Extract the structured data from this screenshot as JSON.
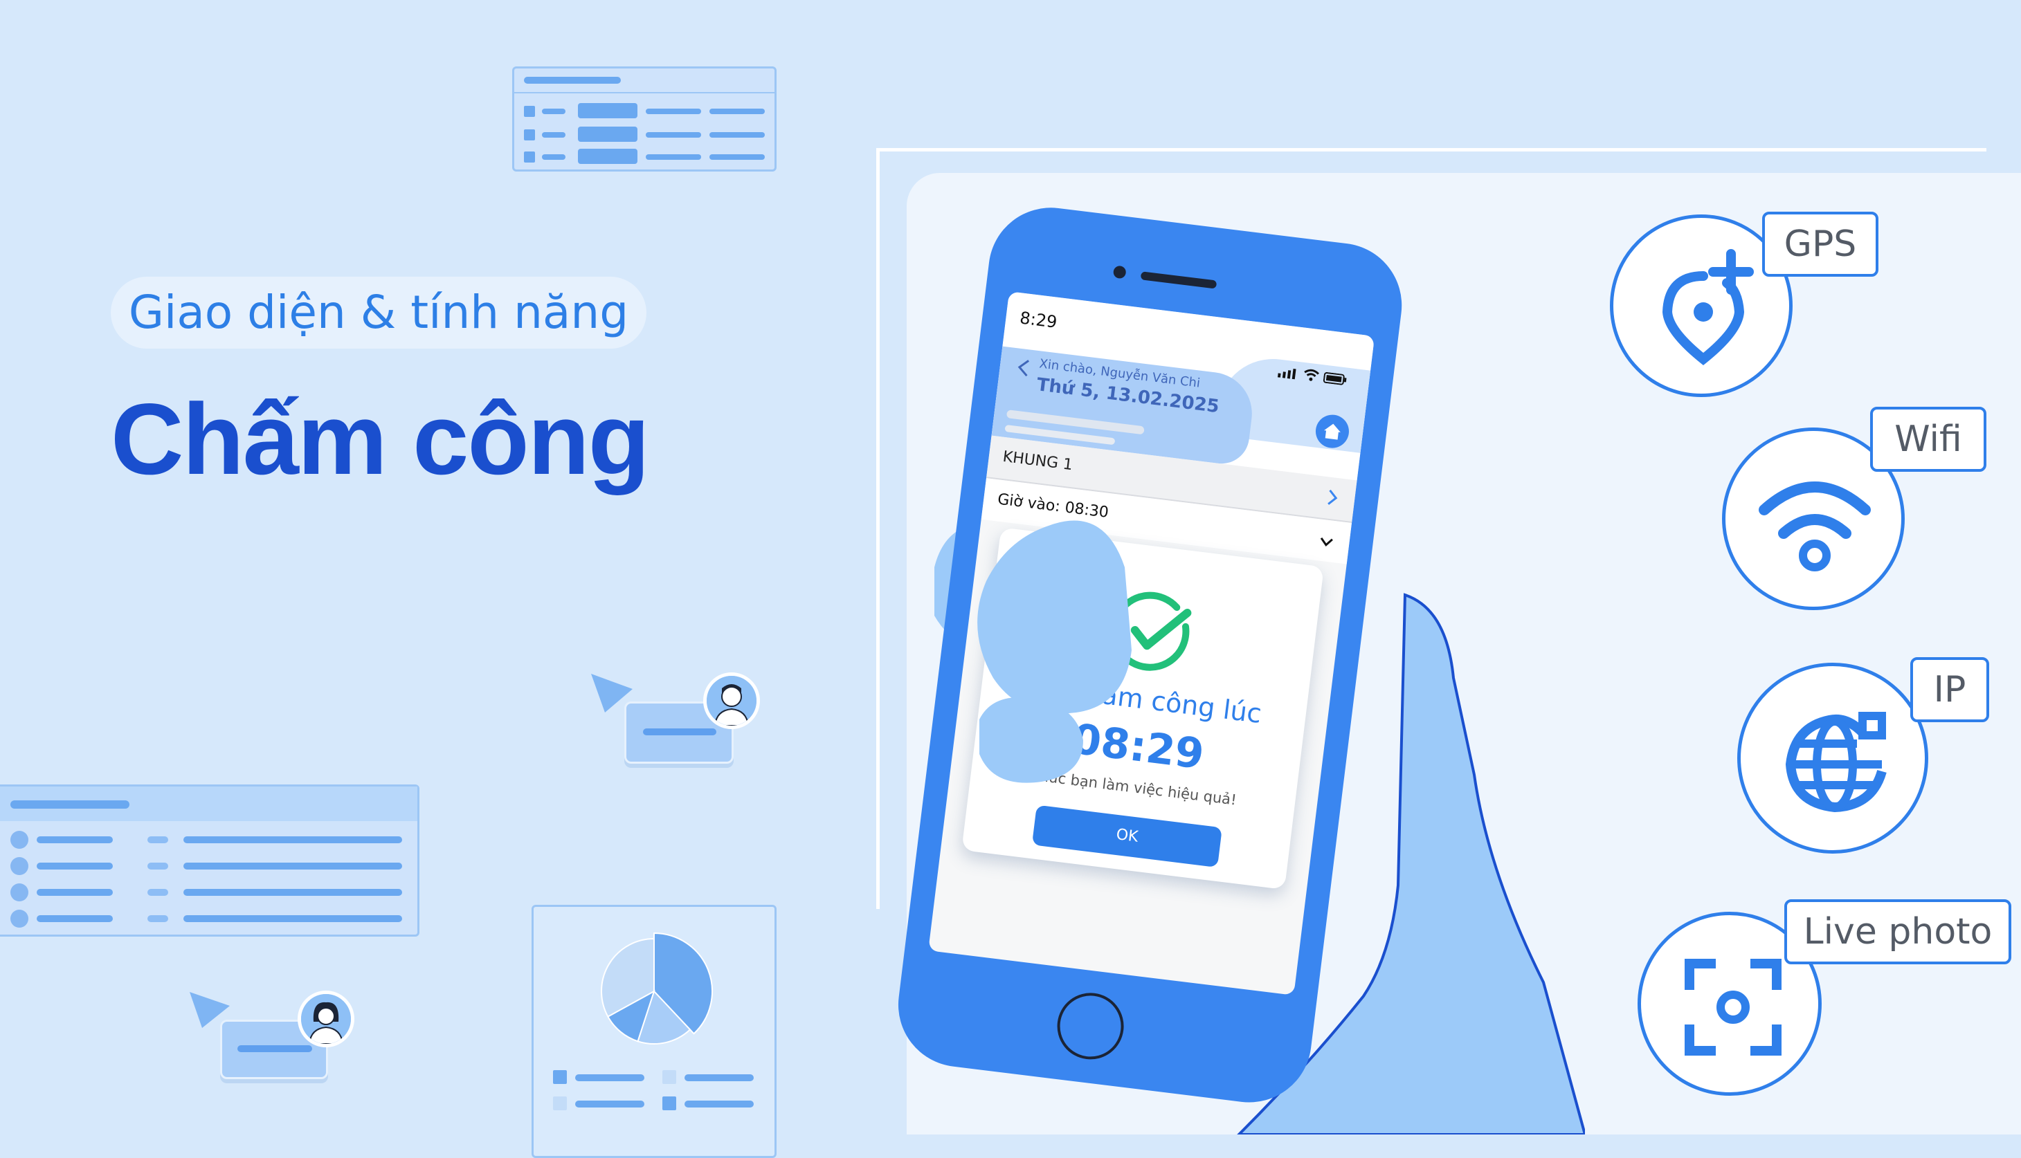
{
  "headline": {
    "subtitle": "Giao diện & tính năng",
    "title": "Chấm công"
  },
  "features": [
    {
      "label": "GPS",
      "icon": "location-add-icon"
    },
    {
      "label": "Wifi",
      "icon": "wifi-icon"
    },
    {
      "label": "IP",
      "icon": "globe-icon"
    },
    {
      "label": "Live photo",
      "icon": "camera-focus-icon"
    }
  ],
  "phone": {
    "status_time": "8:29",
    "greeting": "Xin chào, Nguyễn Văn Chi",
    "date": "Thứ 5, 13.02.2025",
    "section_label": "KHUNG 1",
    "checkin_label": "Giờ vào: 08:30",
    "dialog": {
      "title": "Đã chấm công lúc",
      "time": "08:29",
      "note": "Chúc bạn làm việc hiệu quả!",
      "ok_label": "OK"
    }
  },
  "pie_chart": {
    "slices": [
      0.38,
      0.17,
      0.12,
      0.33
    ]
  },
  "colors": {
    "background": "#d6e8fb",
    "accent": "#2f7fea",
    "title": "#1a4fce",
    "success": "#22c07a",
    "hand": "#9ccaf9"
  }
}
